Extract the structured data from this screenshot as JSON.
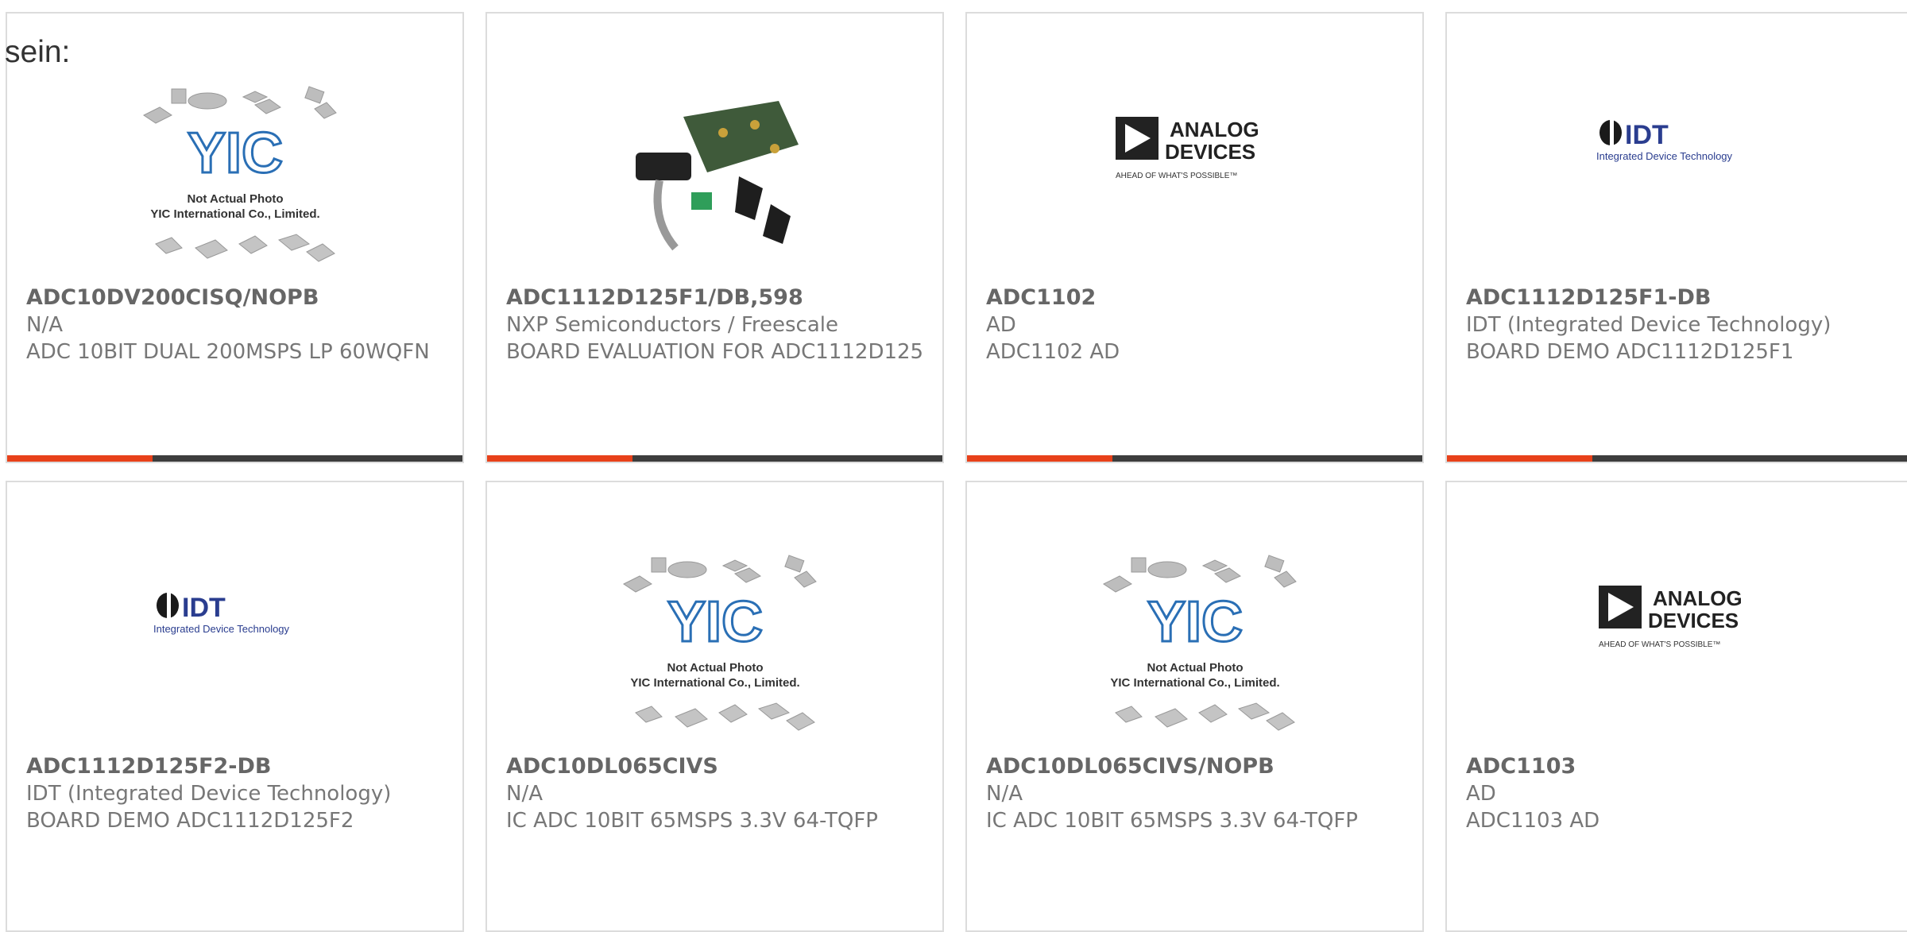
{
  "lead_text": "sein:",
  "placeholder": {
    "line1": "Not Actual Photo",
    "line2": "YIC International Co., Limited."
  },
  "logos": {
    "adi_top": "ANALOG",
    "adi_bottom": "DEVICES",
    "adi_tagline": "AHEAD OF WHAT'S POSSIBLE™",
    "idt_name": "IDT",
    "idt_tagline": "Integrated Device Technology"
  },
  "colors": {
    "accent": "#e8411a",
    "bar": "#3d3d3d",
    "idt_blue": "#2a3d8f"
  },
  "products": [
    {
      "image": "yic-placeholder",
      "part": "ADC10DV200CISQ/NOPB",
      "manufacturer": "N/A",
      "description": "ADC 10BIT DUAL 200MSPS LP 60WQFN"
    },
    {
      "image": "eval-kit-photo",
      "part": "ADC1112D125F1/DB,598",
      "manufacturer": "NXP Semiconductors / Freescale",
      "description": "BOARD EVALUATION FOR ADC1112D125"
    },
    {
      "image": "analog-devices-logo",
      "part": "ADC1102",
      "manufacturer": "AD",
      "description": "ADC1102 AD"
    },
    {
      "image": "idt-logo",
      "part": "ADC1112D125F1-DB",
      "manufacturer": "IDT (Integrated Device Technology)",
      "description": "BOARD DEMO ADC1112D125F1"
    },
    {
      "image": "idt-logo",
      "part": "ADC1112D125F2-DB",
      "manufacturer": "IDT (Integrated Device Technology)",
      "description": "BOARD DEMO ADC1112D125F2"
    },
    {
      "image": "yic-placeholder",
      "part": "ADC10DL065CIVS",
      "manufacturer": "N/A",
      "description": "IC ADC 10BIT 65MSPS 3.3V 64-TQFP"
    },
    {
      "image": "yic-placeholder",
      "part": "ADC10DL065CIVS/NOPB",
      "manufacturer": "N/A",
      "description": "IC ADC 10BIT 65MSPS 3.3V 64-TQFP"
    },
    {
      "image": "analog-devices-logo",
      "part": "ADC1103",
      "manufacturer": "AD",
      "description": "ADC1103 AD"
    }
  ]
}
